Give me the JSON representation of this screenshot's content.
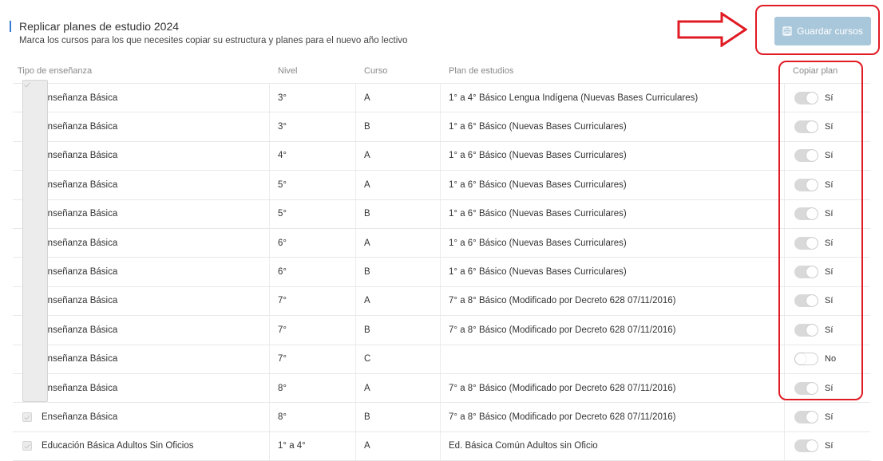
{
  "header": {
    "title": "Replicar planes de estudio 2024",
    "subtitle": "Marca los cursos para los que necesites copiar su estructura y planes para el nuevo año lectivo",
    "save_label": "Guardar cursos",
    "save_icon": "save-icon"
  },
  "table": {
    "columns": {
      "tipo": "Tipo de enseñanza",
      "nivel": "Nivel",
      "curso": "Curso",
      "plan": "Plan de estudios",
      "copiar": "Copiar plan"
    },
    "rows": [
      {
        "tipo": "Enseñanza Básica",
        "nivel": "3°",
        "curso": "A",
        "plan": "1° a 4° Básico Lengua Indígena (Nuevas Bases Curriculares)",
        "copy": "Sí"
      },
      {
        "tipo": "Enseñanza Básica",
        "nivel": "3°",
        "curso": "B",
        "plan": "1° a 6° Básico (Nuevas Bases Curriculares)",
        "copy": "Sí"
      },
      {
        "tipo": "Enseñanza Básica",
        "nivel": "4°",
        "curso": "A",
        "plan": "1° a 6° Básico (Nuevas Bases Curriculares)",
        "copy": "Sí"
      },
      {
        "tipo": "Enseñanza Básica",
        "nivel": "5°",
        "curso": "A",
        "plan": "1° a 6° Básico (Nuevas Bases Curriculares)",
        "copy": "Sí"
      },
      {
        "tipo": "Enseñanza Básica",
        "nivel": "5°",
        "curso": "B",
        "plan": "1° a 6° Básico (Nuevas Bases Curriculares)",
        "copy": "Sí"
      },
      {
        "tipo": "Enseñanza Básica",
        "nivel": "6°",
        "curso": "A",
        "plan": "1° a 6° Básico (Nuevas Bases Curriculares)",
        "copy": "Sí"
      },
      {
        "tipo": "Enseñanza Básica",
        "nivel": "6°",
        "curso": "B",
        "plan": "1° a 6° Básico (Nuevas Bases Curriculares)",
        "copy": "Sí"
      },
      {
        "tipo": "Enseñanza Básica",
        "nivel": "7°",
        "curso": "A",
        "plan": "7° a 8° Básico (Modificado por Decreto 628 07/11/2016)",
        "copy": "Sí"
      },
      {
        "tipo": "Enseñanza Básica",
        "nivel": "7°",
        "curso": "B",
        "plan": "7° a 8° Básico (Modificado por Decreto 628 07/11/2016)",
        "copy": "Sí"
      },
      {
        "tipo": "Enseñanza Básica",
        "nivel": "7°",
        "curso": "C",
        "plan": "",
        "copy": "No"
      },
      {
        "tipo": "Enseñanza Básica",
        "nivel": "8°",
        "curso": "A",
        "plan": "7° a 8° Básico (Modificado por Decreto 628 07/11/2016)",
        "copy": "Sí"
      },
      {
        "tipo": "Enseñanza Básica",
        "nivel": "8°",
        "curso": "B",
        "plan": "7° a 8° Básico (Modificado por Decreto 628 07/11/2016)",
        "copy": "Sí"
      },
      {
        "tipo": "Educación Básica Adultos Sin Oficios",
        "nivel": "1° a 4°",
        "curso": "A",
        "plan": "Ed. Básica Común Adultos sin Oficio",
        "copy": "Sí"
      }
    ]
  },
  "colors": {
    "accent": "#3a7bd5",
    "button_bg": "#a9c7da",
    "annotation": "#e01b24"
  }
}
